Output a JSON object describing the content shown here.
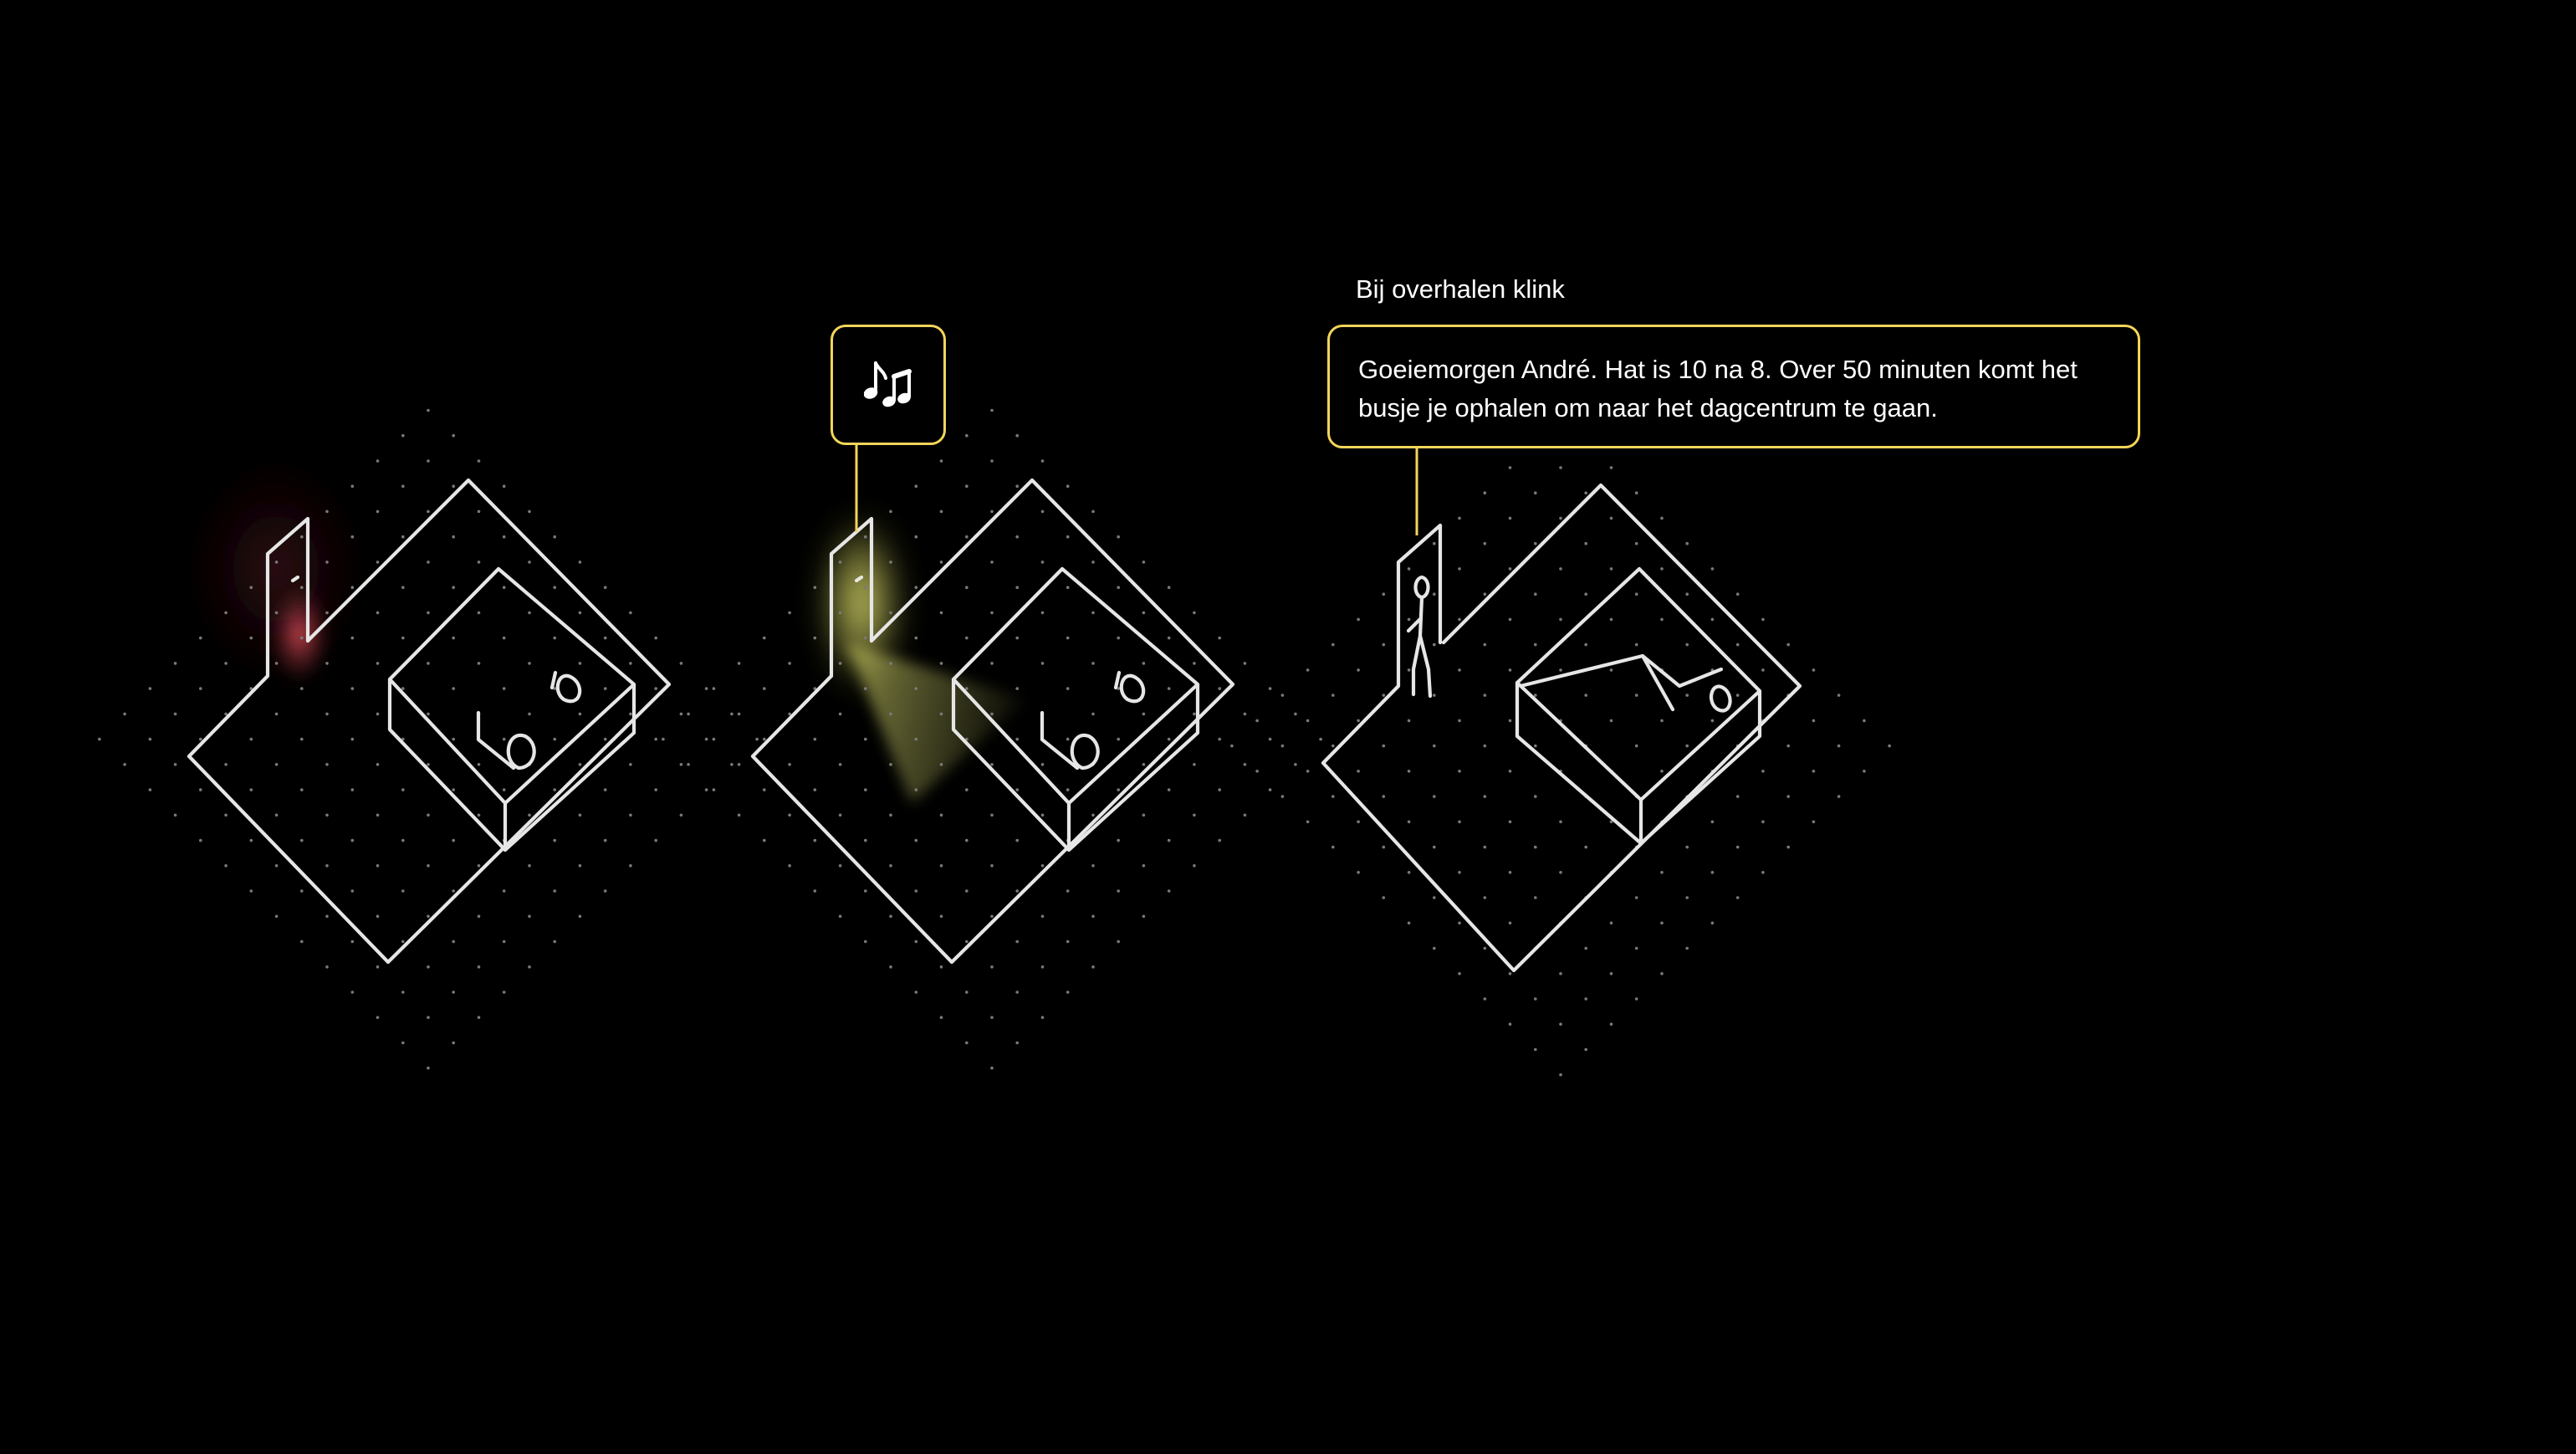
{
  "panels": [
    {
      "id": "panel-1",
      "state": "red-glow-at-door"
    },
    {
      "id": "panel-2",
      "state": "yellow-light-cone",
      "callout": {
        "icon": "music-note-icon"
      }
    },
    {
      "id": "panel-3",
      "state": "person-at-door-bed-empty"
    }
  ],
  "callout_speech": {
    "caption": "Bij overhalen klink",
    "message": "Goeiemorgen André. Hat is 10 na 8. Over 50 minuten komt het busje je ophalen om naar het dagcentrum te gaan."
  },
  "colors": {
    "background": "#000000",
    "sketch_line": "#e6e6e6",
    "callout_border": "#f3d55a",
    "red_glow": "#e8505a",
    "yellow_glow": "#eef07a"
  }
}
